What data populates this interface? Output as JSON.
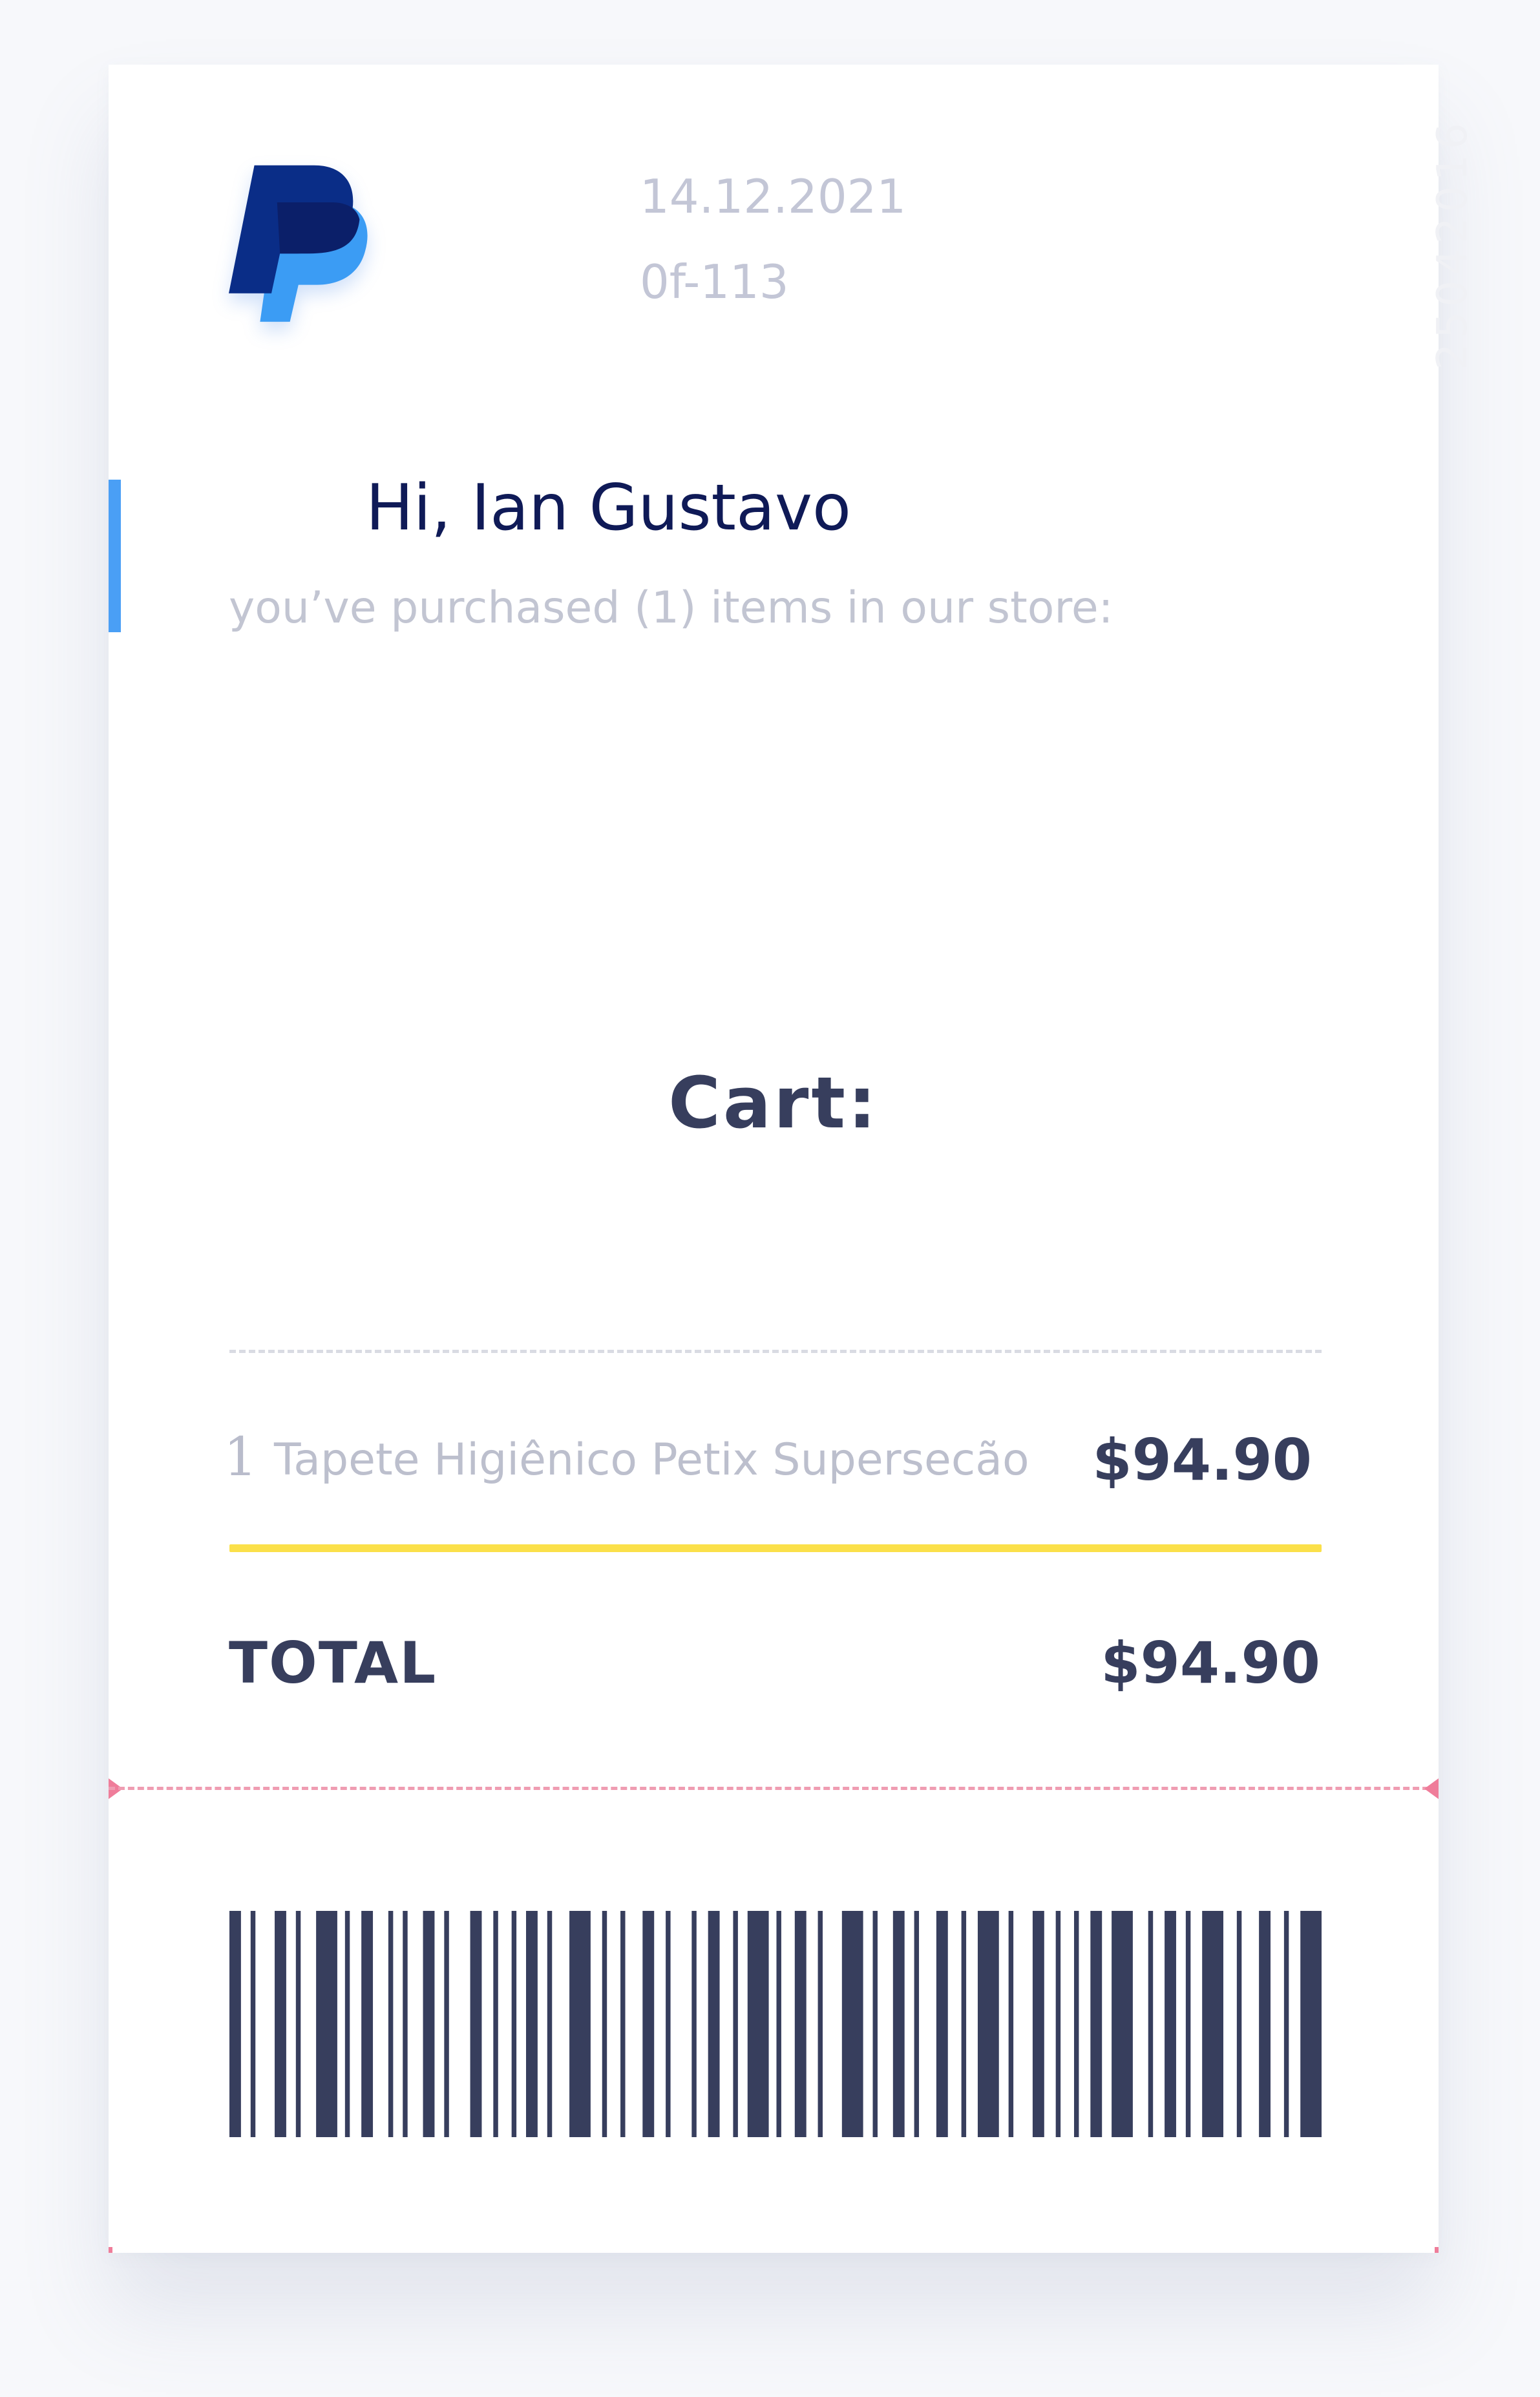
{
  "receipt": {
    "brand_icon": "paypal-logo",
    "date": "14.12.2021",
    "reference": "0f-113",
    "vertical_code": "25042016",
    "greeting": "Hi, Ian Gustavo",
    "summary": "you’ve purchased (1) items in our store:",
    "cart_title": "Cart:",
    "items": [
      {
        "quantity": "1",
        "name": "Tapete Higiênico Petix Supersecão",
        "price": "$94.90"
      }
    ],
    "total_label": "TOTAL",
    "total_value": "$94.90",
    "barcode_icon": "barcode"
  },
  "colors": {
    "accent_blue": "#4a9ff5",
    "highlight_yellow": "#fbe04a",
    "tear_pink": "#ef7d9a",
    "text_dark": "#373e5d",
    "greeting_navy": "#0f1a57",
    "paypal_dark": "#0a2d87",
    "paypal_light": "#3b9cf4"
  }
}
